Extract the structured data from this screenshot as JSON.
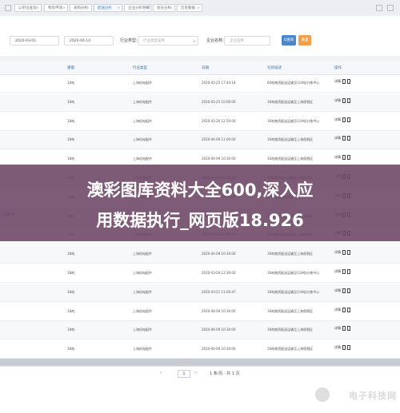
{
  "tabs": [
    {
      "label": "以单位查询"
    },
    {
      "label": "物资申请"
    },
    {
      "label": "采购分析"
    },
    {
      "label": "配送分析"
    },
    {
      "label": "企业分析明细"
    },
    {
      "label": "会员分析"
    },
    {
      "label": "历史数据"
    }
  ],
  "filters": {
    "date_from": "2020-03-01",
    "date_to": "2020-04-14",
    "industry_label": "行业类型:",
    "industry_placeholder": "行业类型名称",
    "enterprise_label": "企业名称:",
    "enterprise_placeholder": "企业名称",
    "query_label": "Q查询",
    "reset_label": "重置"
  },
  "table": {
    "headers": [
      "",
      "重量",
      "行业类型",
      "日期",
      "包装描述",
      "操作"
    ],
    "rows": [
      {
        "weight": "10吨",
        "type": "上海机电配件",
        "date": "2020-03-25 17:44:18",
        "desc": "60吨物资配送运输至(14吨)分拣中心",
        "action": "详情"
      },
      {
        "weight": "18吨",
        "type": "上海机电配件",
        "date": "2020-03-25 10:00:00",
        "desc": "16吨物资配送运输至上海保税区",
        "action": "详情"
      },
      {
        "weight": "18吨",
        "type": "上海机电配件",
        "date": "2020-03-26 12:50:00",
        "desc": "16吨物资配送运输至(14吨)分拣中心",
        "action": "详情"
      },
      {
        "weight": "18吨",
        "type": "上海机电配件",
        "date": "2020-04-09 11:00:00",
        "desc": "16吨物资配送运输至上海保税区",
        "action": "详情"
      },
      {
        "weight": "18吨",
        "type": "上海机电配件",
        "date": "2020-04-09 10:30:00",
        "desc": "16吨物资配送运输至上海保税区",
        "action": "详情"
      },
      {
        "weight": "18吨",
        "type": "上海机电配件",
        "date": "2020-04-09 09:30:00",
        "desc": "16吨物资配送运输至上海保税区",
        "action": "详情"
      },
      {
        "weight": "18吨",
        "type": "上海机电配件",
        "date": "2020-04-10 08:30:00",
        "desc": "16吨物资配送运输至上海保税区",
        "action": "详情"
      },
      {
        "weight": "18吨",
        "type": "上海机电配件",
        "date": "2020-04-10 09:30:00",
        "desc": "16吨物资配送运输至上海保税区",
        "action": "详情"
      },
      {
        "weight": "18吨",
        "type": "上海机电配件",
        "date": "2020-04-03 10:30:00",
        "desc": "16吨物资配送运输至上海保税区",
        "action": "详情"
      },
      {
        "weight": "18吨",
        "type": "上海机电配件",
        "date": "2020-04-09 10:30:00",
        "desc": "16吨物资配送运输至上海保税区",
        "action": "详情"
      },
      {
        "weight": "18吨",
        "type": "上海机电配件",
        "date": "2020-03-26 12:30:00",
        "desc": "16吨物资配送运输至(14吨)分拣中心",
        "action": "详情"
      },
      {
        "weight": "18吨",
        "type": "上海机电配件",
        "date": "2020-03-21 11:00:47",
        "desc": "16吨物资配送运输至(14吨)分拣中心",
        "action": "详情"
      },
      {
        "weight": "18吨",
        "type": "上海机电配件",
        "date": "2020-04-09 10:30:00",
        "desc": "16吨物资配送运输至上海保税区",
        "action": "详情"
      },
      {
        "weight": "18吨",
        "type": "上海机电配件",
        "date": "2020-04-09 10:30:00",
        "desc": "16吨物资配送运输至上海保税区",
        "action": "详情"
      },
      {
        "weight": "18吨",
        "type": "上海机电配件",
        "date": "2020-04-09 10:30:00",
        "desc": "16吨物资配送运输至上海保税区",
        "action": "详情"
      }
    ],
    "side_note": "上海机电"
  },
  "pager": {
    "page": "1",
    "info": "1 条/页 · 共 1 页"
  },
  "overlay": {
    "line1": "澳彩图库资料大全600,深入应",
    "line2": "用数据执行_网页版18.926"
  },
  "watermark": {
    "logo_text": "电子科技网"
  },
  "colors": {
    "query_button": "#4a86c8",
    "reset_button": "#f0a04b",
    "overlay": "#6c4464",
    "header_text": "#3a6fb0"
  }
}
